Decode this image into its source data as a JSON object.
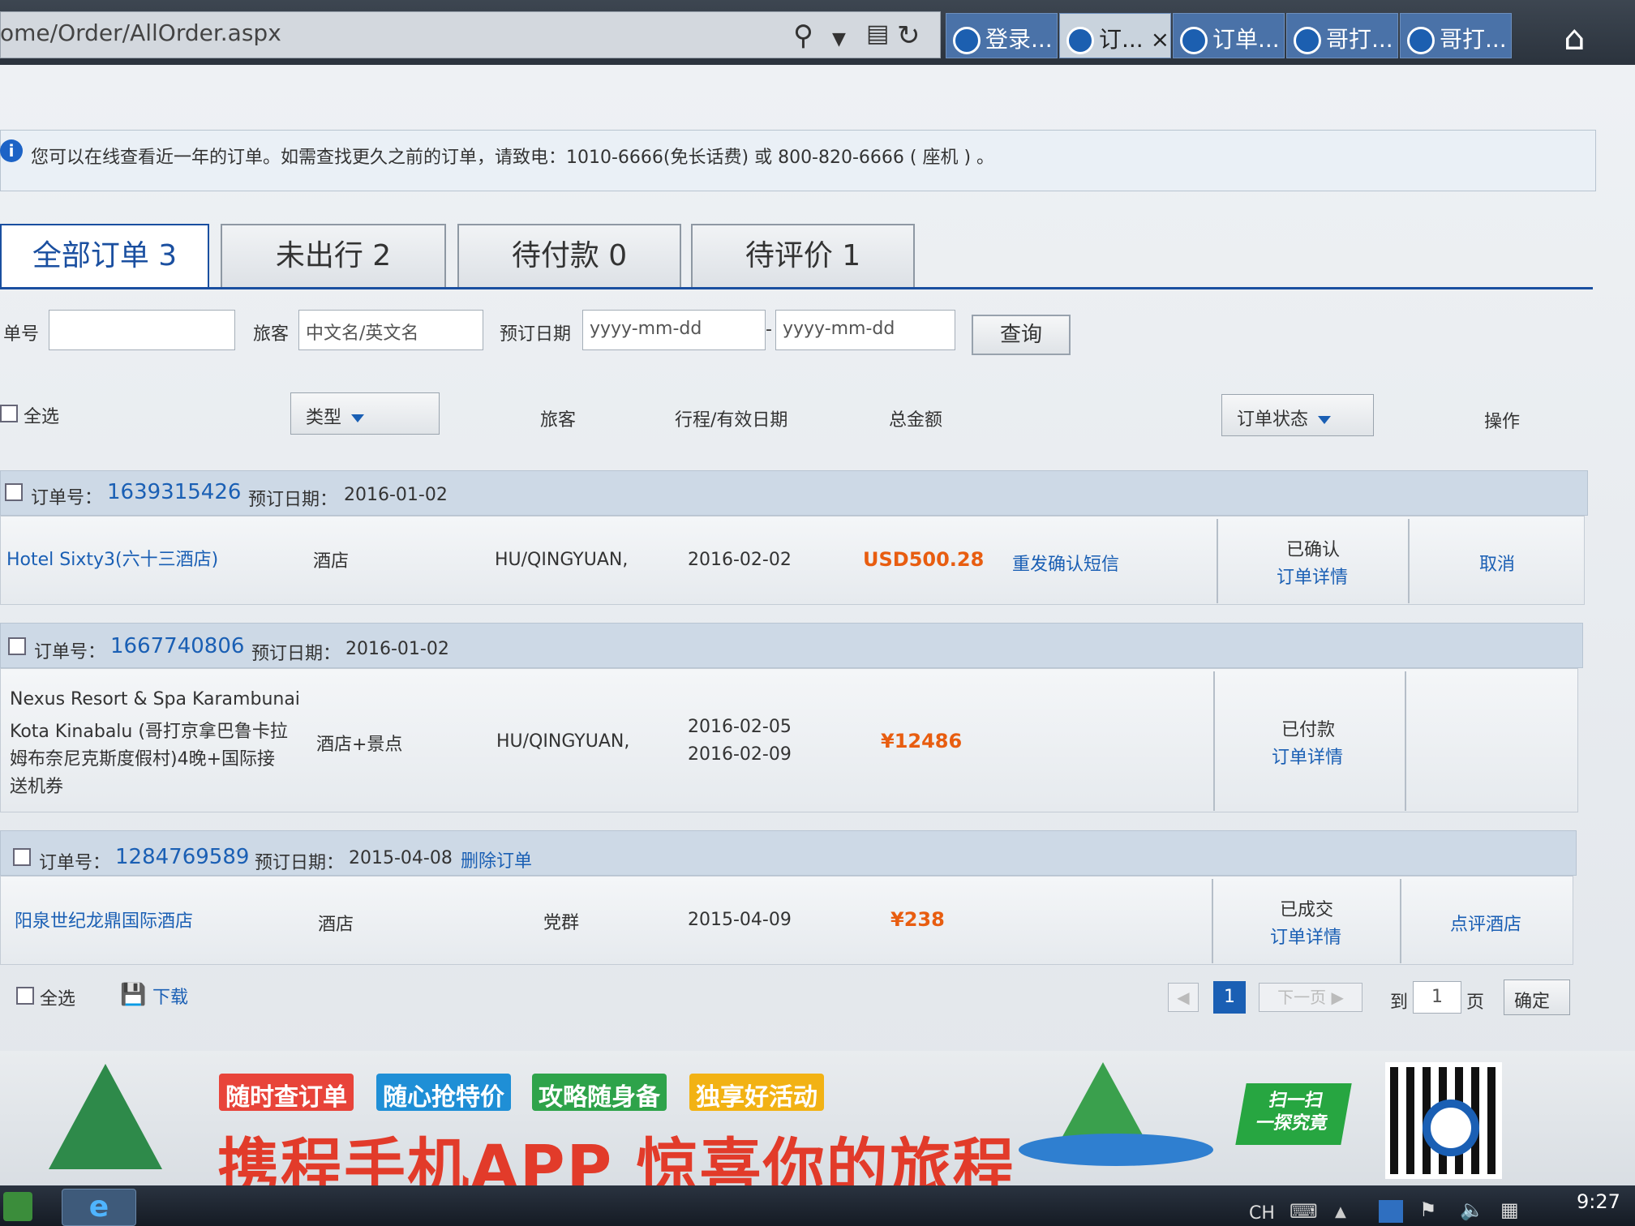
{
  "browser": {
    "address": "ome/Order/AllOrder.aspx",
    "tabs": [
      {
        "label": "登录...",
        "active": false
      },
      {
        "label": "订...",
        "active": true,
        "close": "×"
      },
      {
        "label": "订单...",
        "active": false
      },
      {
        "label": "哥打...",
        "active": false
      },
      {
        "label": "哥打...",
        "active": false
      }
    ]
  },
  "notice": {
    "icon": "i",
    "text": "您可以在线查看近一年的订单。如需查找更久之前的订单，请致电：1010-6666(免长话费) 或 800-820-6666 ( 座机 ) 。"
  },
  "order_tabs": [
    {
      "label": "全部订单 3",
      "active": true
    },
    {
      "label": "未出行 2",
      "active": false
    },
    {
      "label": "待付款 0",
      "active": false
    },
    {
      "label": "待评价 1",
      "active": false
    }
  ],
  "filters": {
    "order_no_label": "单号",
    "order_no_value": "",
    "traveler_label": "旅客",
    "traveler_placeholder": "中文名/英文名",
    "date_label": "预订日期",
    "date_from_placeholder": "yyyy-mm-dd",
    "date_sep": "-",
    "date_to_placeholder": "yyyy-mm-dd",
    "query_button": "查询"
  },
  "table_header": {
    "select_all": "全选",
    "type": "类型",
    "traveler": "旅客",
    "trip_date": "行程/有效日期",
    "total": "总金额",
    "status": "订单状态",
    "action": "操作"
  },
  "orders": [
    {
      "no_label": "订单号：",
      "no": "1639315426",
      "date_label": "预订日期：",
      "date": "2016-01-02",
      "delete": "",
      "product_lines": [
        "Hotel Sixty3(六十三酒店)"
      ],
      "type": "酒店",
      "traveler": "HU/QINGYUAN,",
      "dates": [
        "2016-02-02"
      ],
      "price": "USD500.28",
      "resend": "重发确认短信",
      "status": "已确认",
      "detail": "订单详情",
      "action": "取消"
    },
    {
      "no_label": "订单号：",
      "no": "1667740806",
      "date_label": "预订日期：",
      "date": "2016-01-02",
      "delete": "",
      "product_lines": [
        "Nexus Resort & Spa Karambunai",
        "Kota Kinabalu (哥打京拿巴鲁卡拉",
        "姆布奈尼克斯度假村)4晚+国际接",
        "送机券"
      ],
      "type": "酒店+景点",
      "traveler": "HU/QINGYUAN,",
      "dates": [
        "2016-02-05",
        "2016-02-09"
      ],
      "price": "¥12486",
      "resend": "",
      "status": "已付款",
      "detail": "订单详情",
      "action": ""
    },
    {
      "no_label": "订单号：",
      "no": "1284769589",
      "date_label": "预订日期：",
      "date": "2015-04-08",
      "delete": "删除订单",
      "product_lines": [
        "阳泉世纪龙鼎国际酒店"
      ],
      "type": "酒店",
      "traveler": "党群",
      "dates": [
        "2015-04-09"
      ],
      "price": "¥238",
      "resend": "",
      "status": "已成交",
      "detail": "订单详情",
      "action": "点评酒店"
    }
  ],
  "footer": {
    "select_all": "全选",
    "download": "下载",
    "prev": "◀",
    "current_page": "1",
    "next": "下一页 ▶",
    "goto_label": "到",
    "goto_value": "1",
    "page_unit": "页",
    "confirm": "确定"
  },
  "banner": {
    "tags": [
      "随时查订单",
      "随心抢特价",
      "攻略随身备",
      "独享好活动"
    ],
    "tag_colors": [
      "#e8443a",
      "#1f8fd6",
      "#2ea34a",
      "#f2b214"
    ],
    "headline": "携程手机APP 惊喜你的旅程",
    "scan_lines": [
      "扫一扫",
      "一探究竟"
    ]
  },
  "taskbar": {
    "tray": "CH",
    "clock": "9:27"
  }
}
